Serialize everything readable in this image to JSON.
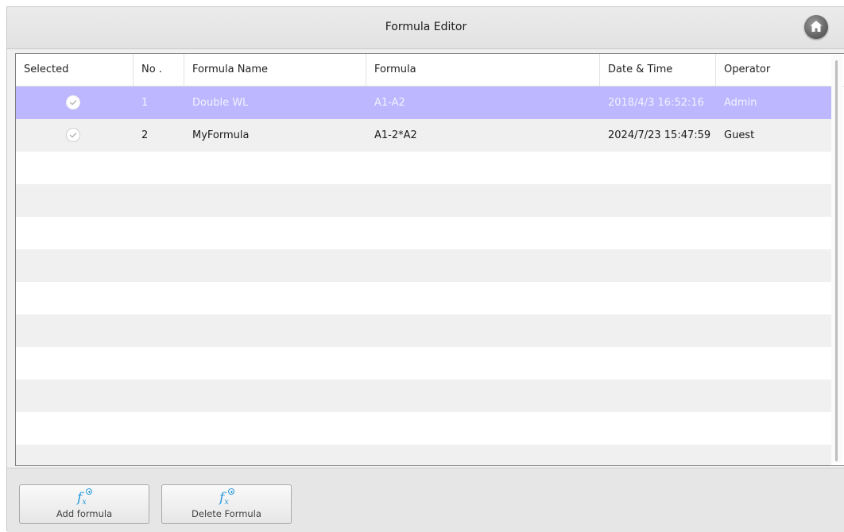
{
  "window": {
    "title": "Formula Editor",
    "home_icon": "home-icon"
  },
  "table": {
    "columns": [
      "Selected",
      "No .",
      "Formula Name",
      "Formula",
      "Date & Time",
      "Operator"
    ],
    "rows": [
      {
        "no": "1",
        "name": "Double WL",
        "formula": "A1-A2",
        "datetime": "2018/4/3 16:52:16",
        "operator": "Admin",
        "selected": true
      },
      {
        "no": "2",
        "name": "MyFormula",
        "formula": "A1-2*A2",
        "datetime": "2024/7/23 15:47:59",
        "operator": "Guest",
        "selected": false
      }
    ],
    "empty_rows": 10
  },
  "toolbar": {
    "add_label": "Add formula",
    "delete_label": "Delete Formula",
    "icon": "function-add-icon"
  },
  "colors": {
    "selected_row": "#bdb7ff",
    "alt_row": "#f0f0f0",
    "icon_accent": "#2a9bdd"
  }
}
